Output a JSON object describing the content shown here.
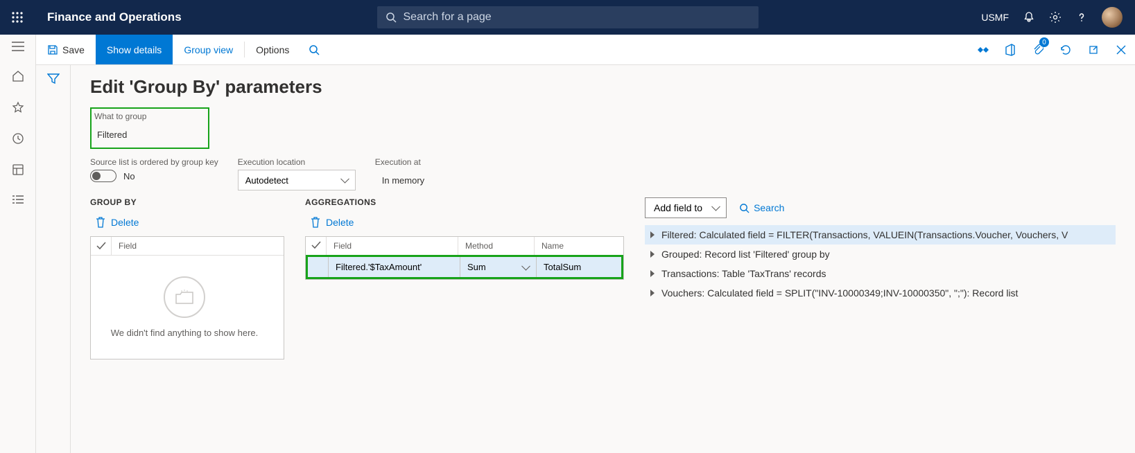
{
  "header": {
    "app_title": "Finance and Operations",
    "search_placeholder": "Search for a page",
    "company": "USMF"
  },
  "actionbar": {
    "save": "Save",
    "show_details": "Show details",
    "group_view": "Group view",
    "options": "Options",
    "badge_count": "0"
  },
  "page": {
    "title": "Edit 'Group By' parameters",
    "what_to_group_label": "What to group",
    "what_to_group_value": "Filtered",
    "ordered_label": "Source list is ordered by group key",
    "ordered_value": "No",
    "exec_location_label": "Execution location",
    "exec_location_value": "Autodetect",
    "exec_at_label": "Execution at",
    "exec_at_value": "In memory"
  },
  "groupby": {
    "heading": "GROUP BY",
    "delete": "Delete",
    "field_col": "Field",
    "empty_text": "We didn't find anything to show here."
  },
  "agg": {
    "heading": "AGGREGATIONS",
    "delete": "Delete",
    "cols": {
      "field": "Field",
      "method": "Method",
      "name": "Name"
    },
    "row": {
      "field": "Filtered.'$TaxAmount'",
      "method": "Sum",
      "name": "TotalSum"
    }
  },
  "right": {
    "add_field": "Add field to",
    "search": "Search",
    "items": [
      "Filtered: Calculated field = FILTER(Transactions, VALUEIN(Transactions.Voucher, Vouchers, V",
      "Grouped: Record list 'Filtered' group by",
      "Transactions: Table 'TaxTrans' records",
      "Vouchers: Calculated field = SPLIT(\"INV-10000349;INV-10000350\", \";\"): Record list"
    ]
  }
}
